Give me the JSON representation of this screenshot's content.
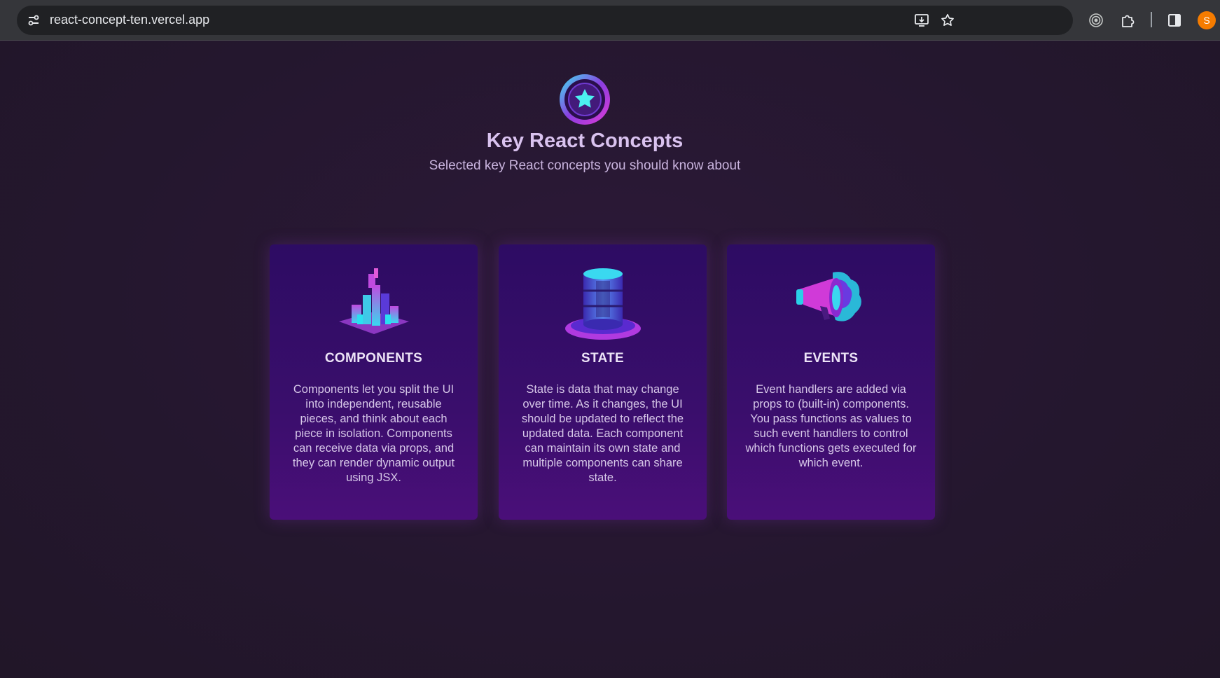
{
  "browser": {
    "url": "react-concept-ten.vercel.app",
    "avatar_letter": "S",
    "icons": [
      "site-info-icon",
      "install-app-icon",
      "bookmark-star-icon",
      "media-router-icon",
      "extensions-icon",
      "side-panel-icon"
    ]
  },
  "header": {
    "title": "Key React Concepts",
    "subtitle": "Selected key React concepts you should know about",
    "logo_icon": "star-badge-icon"
  },
  "concepts": [
    {
      "title": "COMPONENTS",
      "icon": "building-blocks-icon",
      "description": "Components let you split the UI into independent, reusable pieces, and think about each piece in isolation. Components can receive data via props, and they can render dynamic output using JSX."
    },
    {
      "title": "STATE",
      "icon": "database-cylinder-icon",
      "description": "State is data that may change over time. As it changes, the UI should be updated to reflect the updated data. Each component can maintain its own state and multiple components can share state."
    },
    {
      "title": "EVENTS",
      "icon": "megaphone-icon",
      "description": "Event handlers are added via props to (built-in) components. You pass functions as values to such event handlers to control which functions gets executed for which event."
    }
  ],
  "colors": {
    "background": "#25182f",
    "card": "#3a0e6c",
    "title": "#d9c2ef",
    "accent_cyan": "#38e1f0",
    "accent_magenta": "#d03ad8"
  }
}
